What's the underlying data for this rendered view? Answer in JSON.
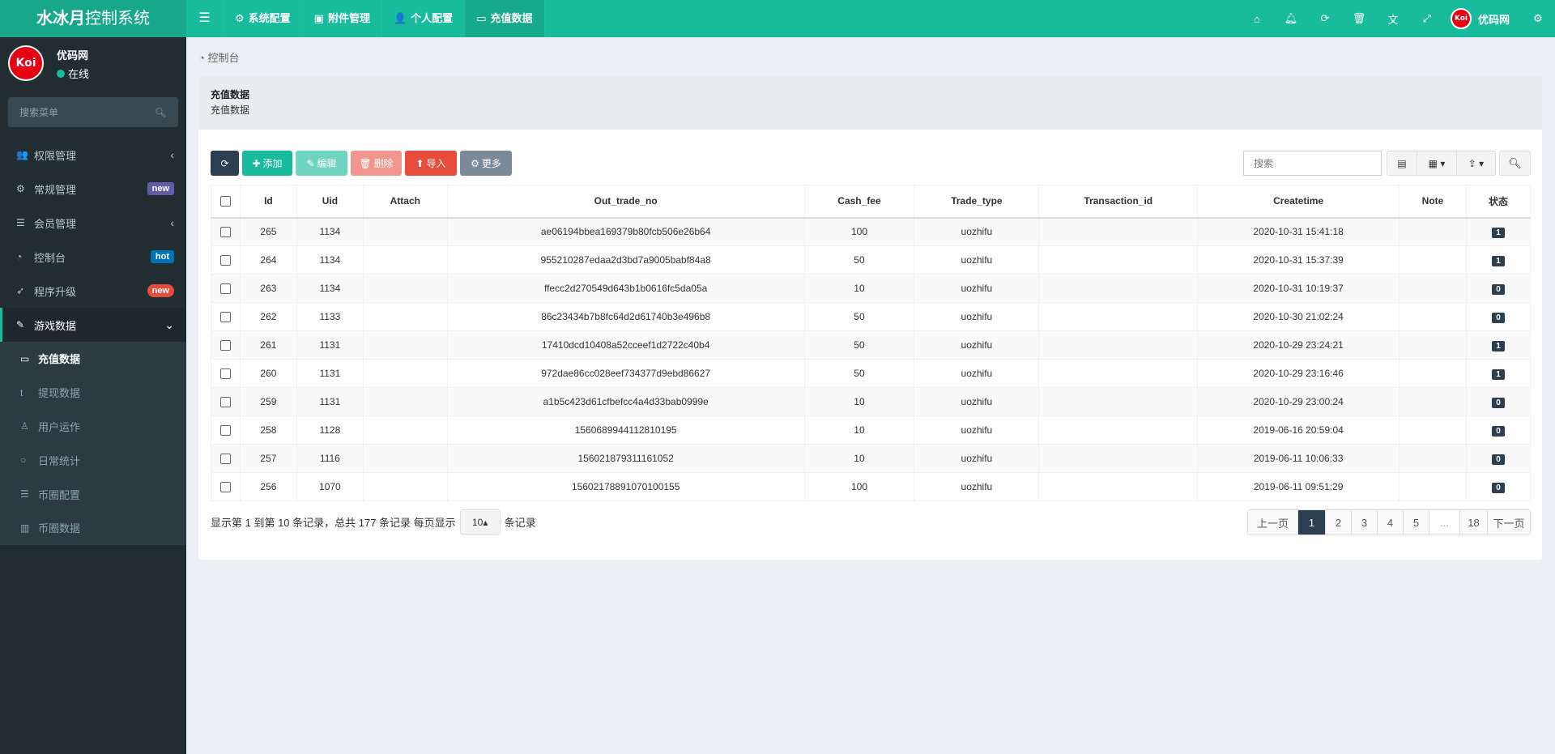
{
  "header": {
    "logo_bold": "水冰月",
    "logo_rest": "控制系统",
    "nav": [
      {
        "icon": "gear-icon",
        "glyph": "⚙",
        "label": "系统配置"
      },
      {
        "icon": "file-image-icon",
        "glyph": "▣",
        "label": "附件管理"
      },
      {
        "icon": "user-icon",
        "glyph": "👤",
        "label": "个人配置"
      },
      {
        "icon": "money-icon",
        "glyph": "▭",
        "label": "充值数据",
        "active": true
      }
    ],
    "user": "优码网",
    "avatar_text": "Koi"
  },
  "sidebar": {
    "user_name": "优码网",
    "status": "在线",
    "search_placeholder": "搜索菜单",
    "items": [
      {
        "icon": "users-icon",
        "glyph": "👥",
        "label": "权限管理",
        "chevron": "‹"
      },
      {
        "icon": "cogs-icon",
        "glyph": "⚙",
        "label": "常规管理",
        "badge": "new",
        "badge_color": "#605ca8"
      },
      {
        "icon": "list-icon",
        "glyph": "☰",
        "label": "会员管理",
        "chevron": "‹"
      },
      {
        "icon": "dashboard-icon",
        "glyph": "◔",
        "label": "控制台",
        "badge": "hot",
        "badge_color": "#0073b7"
      },
      {
        "icon": "rocket-icon",
        "glyph": "➶",
        "label": "程序升级",
        "badge": "new",
        "badge_color": "#e74c3c"
      },
      {
        "icon": "magic-icon",
        "glyph": "✎",
        "label": "游戏数据",
        "chevron": "⌄"
      }
    ],
    "subitems": [
      {
        "icon": "money-icon",
        "glyph": "▭",
        "label": "充值数据",
        "current": true
      },
      {
        "icon": "tumblr-icon",
        "glyph": "t",
        "label": "提现数据"
      },
      {
        "icon": "user-outline-icon",
        "glyph": "♙",
        "label": "用户运作"
      },
      {
        "icon": "circle-icon",
        "glyph": "○",
        "label": "日常统计"
      },
      {
        "icon": "list-icon",
        "glyph": "☰",
        "label": "币圈配置"
      },
      {
        "icon": "bar-chart-icon",
        "glyph": "▥",
        "label": "币圈数据"
      }
    ]
  },
  "breadcrumb": "控制台",
  "panel": {
    "title": "充值数据",
    "subtitle": "充值数据"
  },
  "toolbar": {
    "add": "添加",
    "edit": "编辑",
    "delete": "删除",
    "import": "导入",
    "more": "更多",
    "search_placeholder": "搜索"
  },
  "colors": {
    "primary": "#18bc9c",
    "sidebar": "#222d32",
    "dark": "#2c3e50",
    "danger": "#e74c3c"
  },
  "table": {
    "columns": [
      "Id",
      "Uid",
      "Attach",
      "Out_trade_no",
      "Cash_fee",
      "Trade_type",
      "Transaction_id",
      "Createtime",
      "Note",
      "状态"
    ],
    "rows": [
      [
        "265",
        "1134",
        "",
        "ae06194bbea169379b80fcb506e26b64",
        "100",
        "uozhifu",
        "",
        "2020-10-31 15:41:18",
        "",
        "1"
      ],
      [
        "264",
        "1134",
        "",
        "955210287edaa2d3bd7a9005babf84a8",
        "50",
        "uozhifu",
        "",
        "2020-10-31 15:37:39",
        "",
        "1"
      ],
      [
        "263",
        "1134",
        "",
        "ffecc2d270549d643b1b0616fc5da05a",
        "10",
        "uozhifu",
        "",
        "2020-10-31 10:19:37",
        "",
        "0"
      ],
      [
        "262",
        "1133",
        "",
        "86c23434b7b8fc64d2d61740b3e496b8",
        "50",
        "uozhifu",
        "",
        "2020-10-30 21:02:24",
        "",
        "0"
      ],
      [
        "261",
        "1131",
        "",
        "17410dcd10408a52cceef1d2722c40b4",
        "50",
        "uozhifu",
        "",
        "2020-10-29 23:24:21",
        "",
        "1"
      ],
      [
        "260",
        "1131",
        "",
        "972dae86cc028eef734377d9ebd86627",
        "50",
        "uozhifu",
        "",
        "2020-10-29 23:16:46",
        "",
        "1"
      ],
      [
        "259",
        "1131",
        "",
        "a1b5c423d61cfbefcc4a4d33bab0999e",
        "10",
        "uozhifu",
        "",
        "2020-10-29 23:00:24",
        "",
        "0"
      ],
      [
        "258",
        "1128",
        "",
        "1560689944112810195",
        "10",
        "uozhifu",
        "",
        "2019-06-16 20:59:04",
        "",
        "0"
      ],
      [
        "257",
        "1116",
        "",
        "156021879311161052",
        "10",
        "uozhifu",
        "",
        "2019-06-11 10:06:33",
        "",
        "0"
      ],
      [
        "256",
        "1070",
        "",
        "15602178891070100155",
        "100",
        "uozhifu",
        "",
        "2019-06-11 09:51:29",
        "",
        "0"
      ]
    ]
  },
  "pagination": {
    "info_prefix": "显示第 1 到第 10 条记录，总共 177 条记录 每页显示",
    "page_size": "10",
    "info_suffix": "条记录",
    "prev": "上一页",
    "pages": [
      "1",
      "2",
      "3",
      "4",
      "5",
      "...",
      "18"
    ],
    "current": "1",
    "next": "下一页"
  }
}
